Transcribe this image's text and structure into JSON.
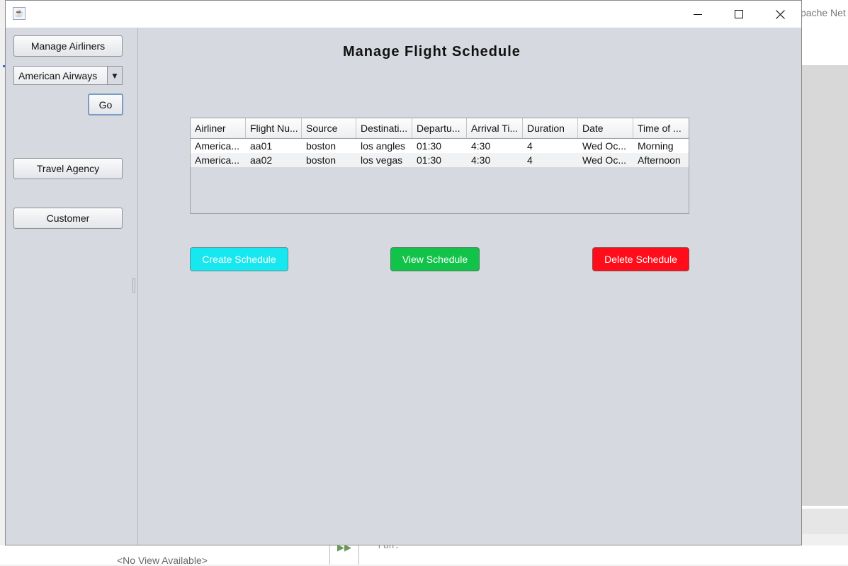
{
  "background": {
    "title_fragment": "pache Net",
    "no_view": "<No View Available>",
    "run_text": "run:"
  },
  "window": {
    "icon": "java-icon",
    "controls": {
      "minimize": "minimize-icon",
      "maximize": "maximize-icon",
      "close": "close-icon"
    }
  },
  "sidebar": {
    "manage_airliners": "Manage Airliners",
    "airline_select": {
      "selected": "American Airways",
      "arrow": "▼"
    },
    "go": "Go",
    "travel_agency": "Travel Agency",
    "customer": "Customer"
  },
  "main": {
    "title": "Manage Flight Schedule",
    "table": {
      "columns": [
        "Airliner",
        "Flight Nu...",
        "Source",
        "Destinati...",
        "Departu...",
        "Arrival Ti...",
        "Duration",
        "Date",
        "Time of ..."
      ],
      "rows": [
        [
          "America...",
          "aa01",
          "boston",
          "los angles",
          "01:30",
          "4:30",
          "4",
          "Wed Oc...",
          "Morning"
        ],
        [
          "America...",
          "aa02",
          "boston",
          "los vegas",
          "01:30",
          "4:30",
          "4",
          "Wed Oc...",
          "Afternoon"
        ]
      ]
    },
    "buttons": {
      "create": "Create Schedule",
      "view": "View Schedule",
      "delete": "Delete Schedule"
    },
    "colors": {
      "create": "#17e7ef",
      "view": "#12c34a",
      "delete": "#ff0d1a"
    }
  }
}
